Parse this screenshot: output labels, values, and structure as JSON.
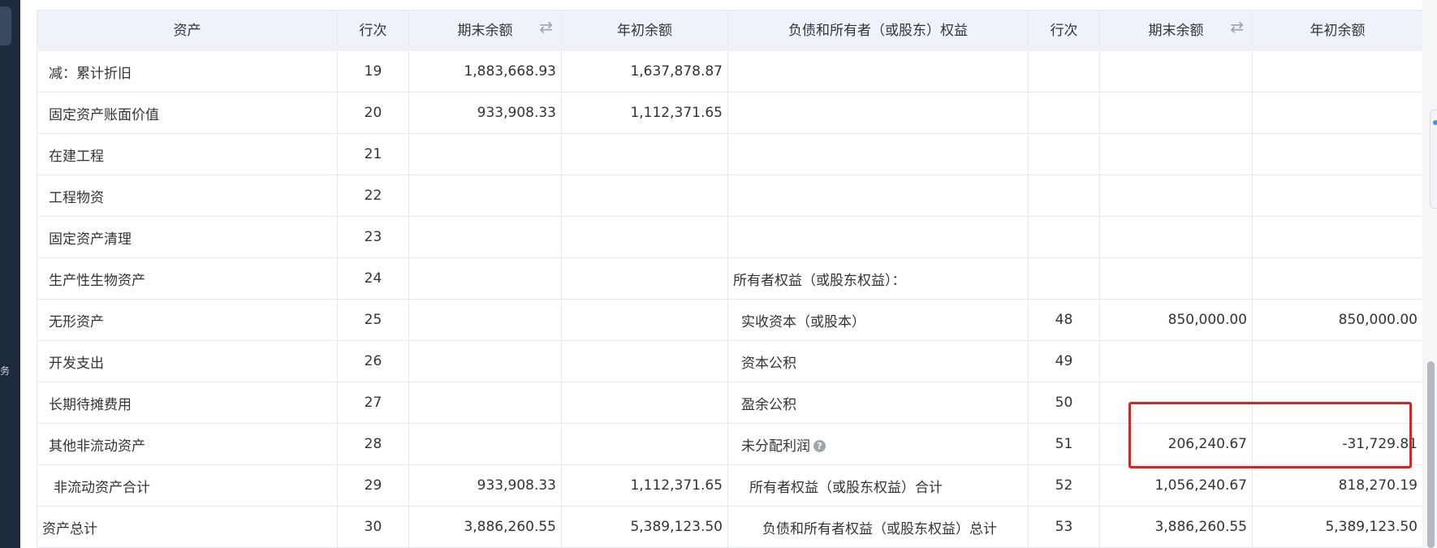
{
  "headers": {
    "asset": "资产",
    "row_no": "行次",
    "end_balance": "期末余额",
    "begin_balance": "年初余额",
    "liability": "负债和所有者（或股东）权益",
    "row_no_2": "行次",
    "end_balance_2": "期末余额",
    "begin_balance_2": "年初余额"
  },
  "icons": {
    "swap_glyph": "⇄",
    "help_glyph": "?"
  },
  "side_glyph": "务",
  "colors": {
    "header_bg": "#eef3fb",
    "selected_row_bg": "#eaf4fd",
    "highlight_row_bg": "#f7fd9b",
    "annotation_box": "#e01f1f"
  },
  "rows": [
    {
      "asset": "减：累计折旧",
      "no": "19",
      "end": "1,883,668.93",
      "begin": "1,637,878.87",
      "liab": "",
      "no2": "",
      "end2": "",
      "begin2": ""
    },
    {
      "asset": "固定资产账面价值",
      "no": "20",
      "end": "933,908.33",
      "begin": "1,112,371.65",
      "liab": "",
      "no2": "",
      "end2": "",
      "begin2": ""
    },
    {
      "asset": "在建工程",
      "no": "21",
      "end": "",
      "begin": "",
      "liab": "",
      "no2": "",
      "end2": "",
      "begin2": ""
    },
    {
      "asset": "工程物资",
      "no": "22",
      "end": "",
      "begin": "",
      "liab": "",
      "no2": "",
      "end2": "",
      "begin2": ""
    },
    {
      "asset": "固定资产清理",
      "no": "23",
      "end": "",
      "begin": "",
      "liab": "",
      "no2": "",
      "end2": "",
      "begin2": ""
    },
    {
      "asset": "生产性生物资产",
      "no": "24",
      "end": "",
      "begin": "",
      "liab": "所有者权益（或股东权益）：",
      "no2": "",
      "end2": "",
      "begin2": ""
    },
    {
      "asset": "无形资产",
      "no": "25",
      "end": "",
      "begin": "",
      "liab": "实收资本（或股本）",
      "no2": "48",
      "end2": "850,000.00",
      "begin2": "850,000.00"
    },
    {
      "asset": "开发支出",
      "no": "26",
      "end": "",
      "begin": "",
      "liab": "资本公积",
      "no2": "49",
      "end2": "",
      "begin2": ""
    },
    {
      "asset": "长期待摊费用",
      "no": "27",
      "end": "",
      "begin": "",
      "liab": "盈余公积",
      "no2": "50",
      "end2": "",
      "begin2": ""
    },
    {
      "asset": "其他非流动资产",
      "no": "28",
      "end": "",
      "begin": "",
      "liab": "未分配利润",
      "no2": "51",
      "end2": "206,240.67",
      "begin2": "-31,729.81"
    },
    {
      "asset": "非流动资产合计",
      "no": "29",
      "end": "933,908.33",
      "begin": "1,112,371.65",
      "liab": "所有者权益（或股东权益）合计",
      "no2": "52",
      "end2": "1,056,240.67",
      "begin2": "818,270.19"
    },
    {
      "asset": "资产总计",
      "no": "30",
      "end": "3,886,260.55",
      "begin": "5,389,123.50",
      "liab": "负债和所有者权益（或股东权益）总计",
      "no2": "53",
      "end2": "3,886,260.55",
      "begin2": "5,389,123.50"
    }
  ]
}
